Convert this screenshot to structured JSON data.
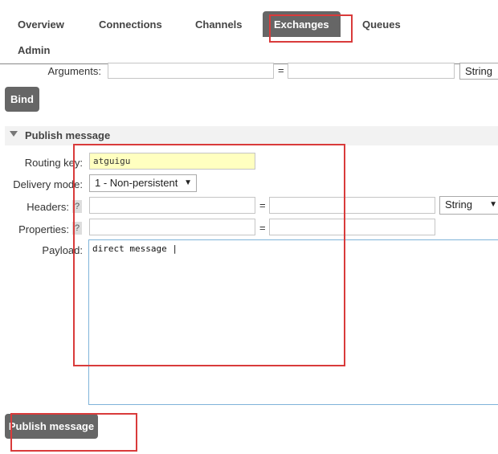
{
  "nav": {
    "tabs": [
      "Overview",
      "Connections",
      "Channels",
      "Exchanges",
      "Queues",
      "Admin"
    ],
    "active": "Exchanges"
  },
  "bind_section": {
    "arguments_label": "Arguments:",
    "equals": "=",
    "type_value": "String",
    "bind_button": "Bind"
  },
  "publish": {
    "section_title": "Publish message",
    "routing_key_label": "Routing key:",
    "routing_key_value": "atguigu",
    "delivery_mode_label": "Delivery mode:",
    "delivery_mode_value": "1 - Non-persistent",
    "headers_label": "Headers:",
    "headers_type": "String",
    "properties_label": "Properties:",
    "help_mark": "?",
    "equals": "=",
    "payload_label": "Payload:",
    "payload_value": "direct message |",
    "publish_button": "Publish message"
  },
  "colors": {
    "highlight_red": "#d93b3b",
    "nav_active": "#666666",
    "routing_key_bg": "#ffffc0",
    "payload_border": "#7fb3d9"
  }
}
